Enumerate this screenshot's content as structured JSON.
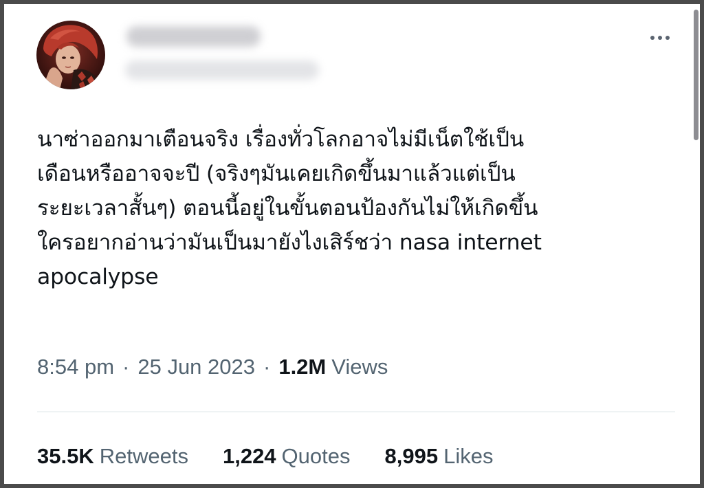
{
  "tweet": {
    "text": "นาซ่าออกมาเตือนจริง เรื่องทั่วโลกอาจไม่มีเน็ตใช้เป็น\nเดือนหรืออาจจะปี (จริงๆมันเคยเกิดขึ้นมาแล้วแต่เป็น\nระยะเวลาสั้นๆ) ตอนนี้อยู่ในขั้นตอนป้องกันไม่ให้เกิดขึ้น\nใครอยากอ่านว่ามันเป็นมายังไงเสิร์ชว่า nasa internet\napocalypse",
    "time": "8:54 pm",
    "separator": "·",
    "date": "25 Jun 2023",
    "views_count": "1.2M",
    "views_label": "Views"
  },
  "stats": {
    "retweets_count": "35.5K",
    "retweets_label": "Retweets",
    "quotes_count": "1,224",
    "quotes_label": "Quotes",
    "likes_count": "8,995",
    "likes_label": "Likes"
  },
  "icons": {
    "more": "more-horizontal-icon"
  },
  "colors": {
    "text_primary": "#0f1419",
    "text_secondary": "#536471",
    "divider": "#eff3f4",
    "frame": "#4b4b4b"
  }
}
